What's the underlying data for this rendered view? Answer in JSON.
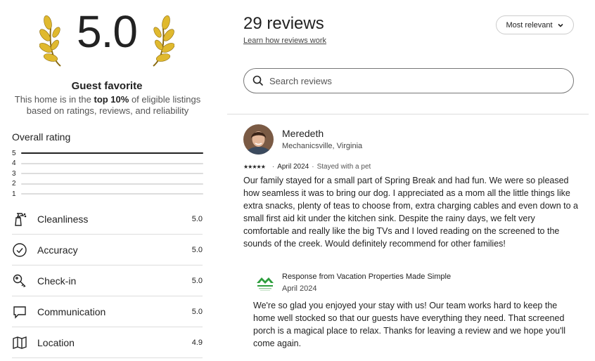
{
  "summary": {
    "score": "5.0",
    "badge_title": "Guest favorite",
    "badge_desc_pre": "This home is in the ",
    "badge_desc_bold": "top 10%",
    "badge_desc_post": " of eligible listings based on ratings, reviews, and reliability"
  },
  "overall": {
    "title": "Overall rating",
    "bars": [
      {
        "label": "5",
        "fraction": 1.0
      },
      {
        "label": "4",
        "fraction": 0
      },
      {
        "label": "3",
        "fraction": 0
      },
      {
        "label": "2",
        "fraction": 0
      },
      {
        "label": "1",
        "fraction": 0
      }
    ]
  },
  "categories": [
    {
      "label": "Cleanliness",
      "value": "5.0",
      "icon": "spray-bottle-icon"
    },
    {
      "label": "Accuracy",
      "value": "5.0",
      "icon": "check-circle-icon"
    },
    {
      "label": "Check-in",
      "value": "5.0",
      "icon": "key-icon"
    },
    {
      "label": "Communication",
      "value": "5.0",
      "icon": "chat-bubble-icon"
    },
    {
      "label": "Location",
      "value": "4.9",
      "icon": "map-icon"
    }
  ],
  "reviews_header": {
    "count": "29 reviews",
    "learn_link": "Learn how reviews work",
    "sort_label": "Most relevant"
  },
  "search": {
    "placeholder": "Search reviews"
  },
  "review": {
    "name": "Meredeth",
    "location": "Mechanicsville, Virginia",
    "stars": "★★★★★",
    "date": "April 2024",
    "tag": "Stayed with a pet",
    "text": "Our family stayed for a small part of Spring Break and had fun.  We were so pleased how seamless it was to bring our dog.  I appreciated as a mom all the little things like extra snacks, plenty of teas to choose from, extra charging cables and even down to a small first aid kit under the kitchen sink.  Despite the rainy days, we felt very comfortable and really like the big TVs and I loved reading on the screened to the sounds of the creek.  Would definitely recommend for other families!"
  },
  "response": {
    "title": "Response from Vacation Properties Made Simple",
    "date": "April 2024",
    "text": "We're so glad you enjoyed your stay with us! Our team works hard to keep the home well stocked so that our guests have everything they need. That screened porch is a magical place to relax. Thanks for leaving a review and we hope you'll come again."
  },
  "colors": {
    "bar_fill": "#222222",
    "bar_track": "#dddddd",
    "logo_green": "#2e9e3e"
  }
}
